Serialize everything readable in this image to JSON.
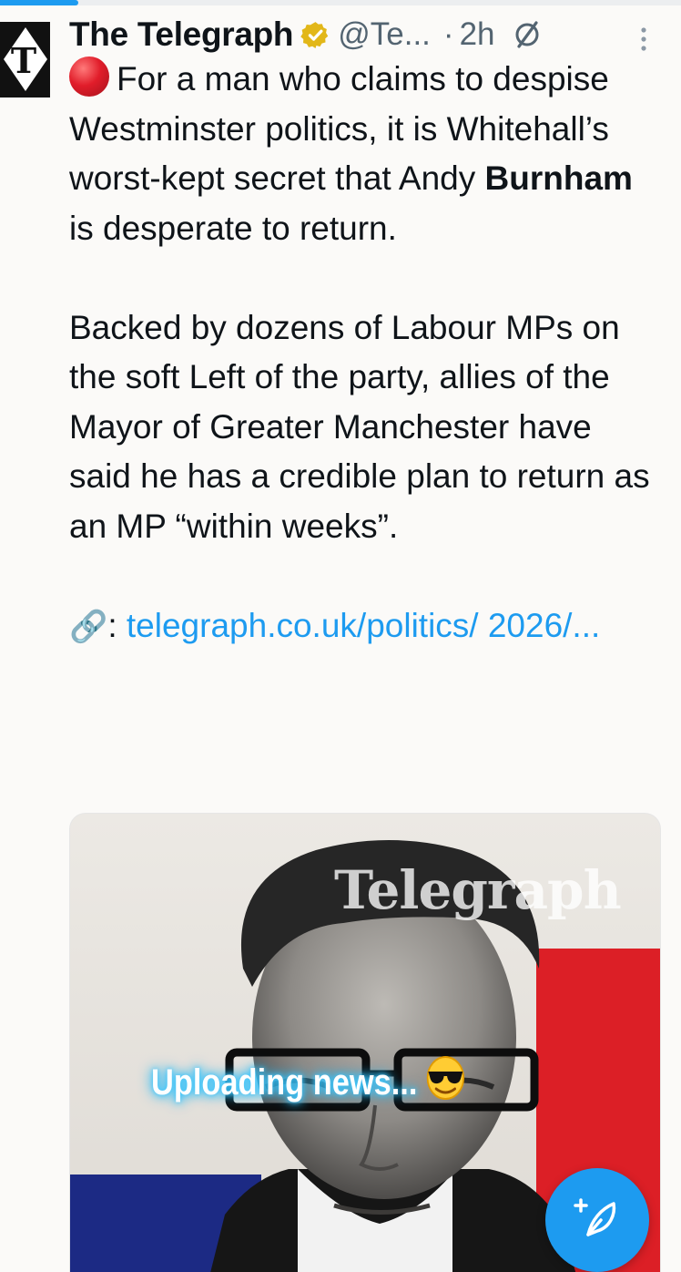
{
  "progress": {
    "fraction": 0.115,
    "color": "#1d9bf0"
  },
  "tweet": {
    "author_name": "The Telegraph",
    "handle": "@Te...",
    "separator": "·",
    "time": "2h",
    "paragraph1_before_bold": "For a man who claims to despise Westminster politics, it is Whitehall’s worst-kept secret that Andy ",
    "paragraph1_bold": "Burnham",
    "paragraph1_after_bold": " is desperate to return.",
    "paragraph2": "Backed by dozens of Labour MPs on the soft Left of the party, allies of the Mayor of Greater Manchester have said he has a credible plan to return as an MP “within weeks”.",
    "link_emoji": "🔗",
    "link_prefix": ": ",
    "link_text": "telegraph.co.uk/politics/ 2026/...",
    "media_watermark": "Telegraph"
  },
  "overlay": {
    "text": "Uploading news...",
    "emoji": "😎"
  },
  "icons": {
    "avatar": "telegraph-logo-icon",
    "verified": "verified-badge-icon",
    "grok": "grok-icon",
    "more": "more-vertical-icon",
    "compose": "compose-post-icon",
    "red_circle": "red-circle-icon"
  },
  "colors": {
    "accent": "#1d9bf0",
    "verified_gold": "#e2b719",
    "text": "#0f1419",
    "secondary_text": "#536471"
  }
}
